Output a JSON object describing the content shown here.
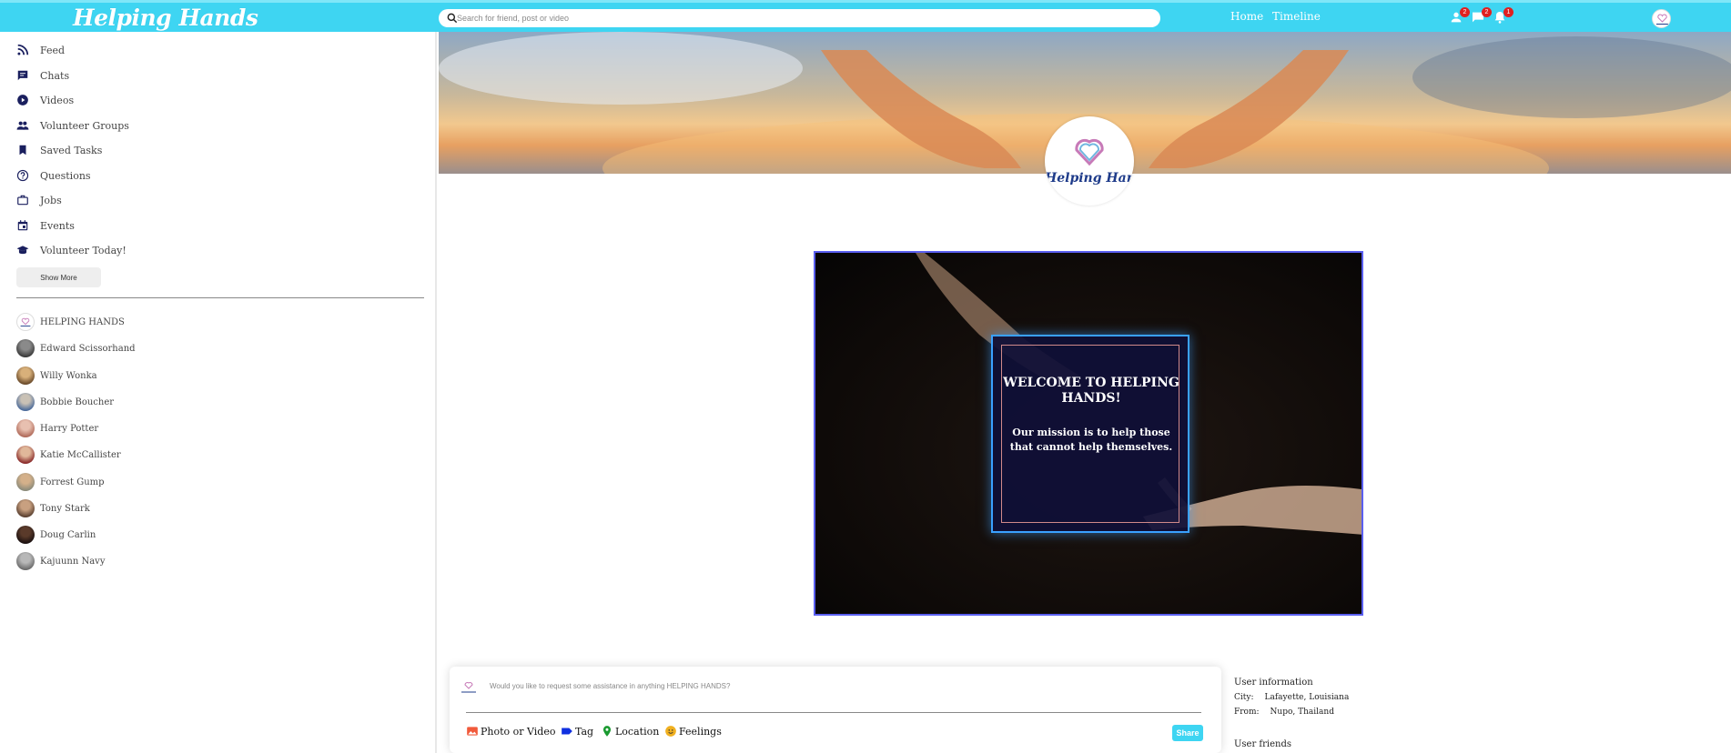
{
  "header": {
    "logo": "Helping Hands",
    "search_placeholder": "Search for friend, post or video",
    "nav": [
      "Home",
      "Timeline"
    ],
    "badges": {
      "person": "2",
      "chat": "2",
      "notifications": "1"
    }
  },
  "sidebar": {
    "menu": [
      {
        "label": "Feed",
        "icon": "rss-icon"
      },
      {
        "label": "Chats",
        "icon": "chat-icon"
      },
      {
        "label": "Videos",
        "icon": "play-circle-icon"
      },
      {
        "label": "Volunteer Groups",
        "icon": "group-icon"
      },
      {
        "label": "Saved Tasks",
        "icon": "bookmark-icon"
      },
      {
        "label": "Questions",
        "icon": "help-circle-icon"
      },
      {
        "label": "Jobs",
        "icon": "briefcase-icon"
      },
      {
        "label": "Events",
        "icon": "calendar-icon"
      },
      {
        "label": "Volunteer Today!",
        "icon": "school-icon"
      }
    ],
    "show_more": "Show More",
    "friends": [
      "HELPING HANDS",
      "Edward Scissorhand",
      "Willy Wonka",
      "Bobbie Boucher",
      "Harry Potter",
      "Katie McCallister",
      "Forrest Gump",
      "Tony Stark",
      "Doug Carlin",
      "Kajuunn Navy"
    ]
  },
  "profile": {
    "logo_text": "Helping Hand"
  },
  "welcome": {
    "title": "WELCOME TO HELPING HANDS!",
    "mission": "Our mission is to help those that cannot help themselves."
  },
  "share": {
    "placeholder": "Would you like to request some assistance in anything HELPING HANDS?",
    "options": [
      "Photo or Video",
      "Tag",
      "Location",
      "Feelings"
    ],
    "button": "Share"
  },
  "user_info": {
    "title": "User information",
    "city_label": "City:",
    "city": "Lafayette, Louisiana",
    "from_label": "From:",
    "from": "Nupo, Thailand",
    "friends_title": "User friends"
  },
  "colors": {
    "accent": "#3ed5f2",
    "icon": "#1a1f5e",
    "badge": "#e02020"
  }
}
